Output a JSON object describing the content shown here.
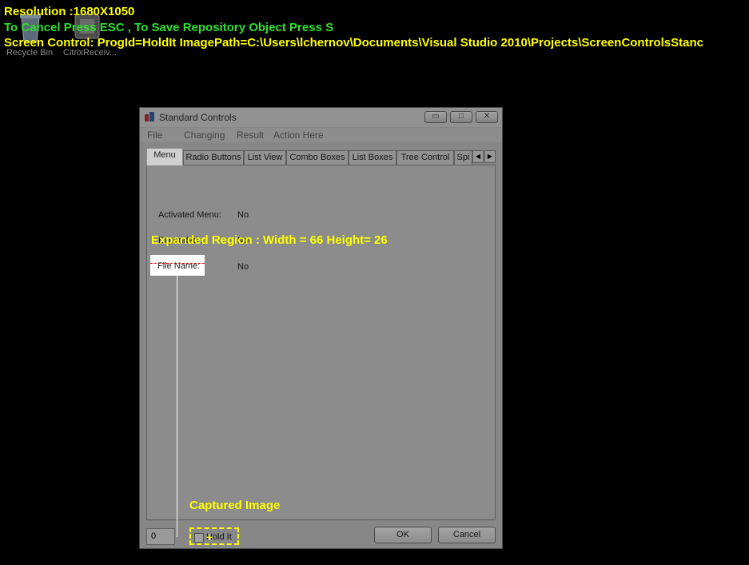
{
  "overlay": {
    "resolution": "Resolution :1680X1050",
    "instructions": "To Cancel Press ESC , To Save Repository Object Press S",
    "screen_control": "Screen Control: ProgId=HoldIt ImagePath=C:\\Users\\lchernov\\Documents\\Visual Studio 2010\\Projects\\ScreenControlsStanc",
    "expanded_region": "Expanded Region : Width = 66  Height= 26",
    "captured_image": "Captured Image"
  },
  "desktop": {
    "icons": [
      {
        "label": "Recycle Bin",
        "icon": "recycle-bin-icon"
      },
      {
        "label": "CitrixReceiv...",
        "icon": "citrix-receiver-icon"
      }
    ]
  },
  "window": {
    "title": "Standard Controls",
    "controls": {
      "minimize": "▭",
      "maximize": "□",
      "close": "✕"
    },
    "menu": [
      "File",
      "Changing",
      "Result",
      "Action Here"
    ],
    "tabs": [
      "Menu",
      "Radio Buttons",
      "List View",
      "Combo Boxes",
      "List Boxes",
      "Tree Control",
      "Spi"
    ],
    "active_tab": "Menu",
    "fields": [
      {
        "label": "Activated Menu:",
        "value": "No"
      },
      {
        "label": "Expanded...",
        "value": "No"
      },
      {
        "label": "File Name:",
        "value": "No"
      }
    ],
    "bottom_value": "0",
    "hold_it_label": "Hold It",
    "ok_label": "OK",
    "cancel_label": "Cancel"
  }
}
